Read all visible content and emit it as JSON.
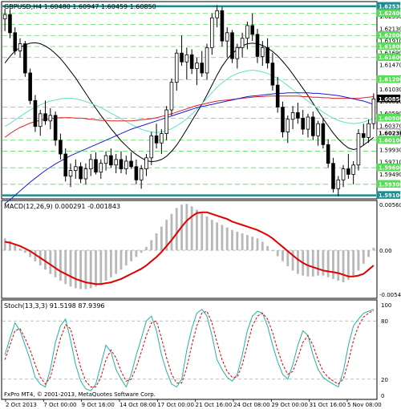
{
  "chart_data": {
    "type": "candlestick",
    "symbol_header": "GBPUSD,H4  1.60480 1.60947 1.60459 1.60850",
    "price_axis": {
      "labels": [
        "1.62350",
        "1.62130",
        "1.61910",
        "1.61690",
        "1.61470",
        "1.61250",
        "1.61030",
        "1.60810",
        "1.60590",
        "1.60370",
        "1.60150",
        "1.59930",
        "1.59710",
        "1.59490"
      ],
      "range": [
        1.5905,
        1.626
      ]
    },
    "horizontal_levels": {
      "heavy": [
        1.6253,
        1.591
      ],
      "dashed": [
        1.624,
        1.622,
        1.62,
        1.618,
        1.616,
        1.612,
        1.607,
        1.605,
        1.601,
        1.599,
        1.596,
        1.593
      ],
      "labels": [
        {
          "value": "1.62530",
          "level": 1.6253,
          "color": "#1e8c8c"
        },
        {
          "value": "1.62400",
          "level": 1.624,
          "color": "#55dd55"
        },
        {
          "value": "1.62000",
          "level": 1.62,
          "color": "#55dd55"
        },
        {
          "value": "1.61800",
          "level": 1.618,
          "color": "#55dd55"
        },
        {
          "value": "1.61600",
          "level": 1.616,
          "color": "#55dd55"
        },
        {
          "value": "1.61200",
          "level": 1.612,
          "color": "#55dd55"
        },
        {
          "value": "1.60850",
          "level": 1.6085,
          "color": "#000000"
        },
        {
          "value": "1.60500",
          "level": 1.605,
          "color": "#55dd55"
        },
        {
          "value": "1.60230",
          "level": 1.6023,
          "color": "#ffffff"
        },
        {
          "value": "1.60100",
          "level": 1.601,
          "color": "#55dd55"
        },
        {
          "value": "1.59600",
          "level": 1.596,
          "color": "#55dd55"
        },
        {
          "value": "1.59300",
          "level": 1.593,
          "color": "#55dd55"
        },
        {
          "value": "1.59100",
          "level": 1.591,
          "color": "#1e8c8c"
        }
      ]
    },
    "candles": [
      [
        1.623,
        1.6248,
        1.6208,
        1.6238
      ],
      [
        1.6238,
        1.6248,
        1.6195,
        1.6205
      ],
      [
        1.6205,
        1.6215,
        1.6165,
        1.6172
      ],
      [
        1.6172,
        1.6195,
        1.616,
        1.6185
      ],
      [
        1.6185,
        1.619,
        1.6125,
        1.6132
      ],
      [
        1.6132,
        1.614,
        1.6075,
        1.6082
      ],
      [
        1.6082,
        1.6092,
        1.6025,
        1.6035
      ],
      [
        1.6035,
        1.6065,
        1.6018,
        1.6058
      ],
      [
        1.6058,
        1.6082,
        1.6038,
        1.6045
      ],
      [
        1.6045,
        1.6068,
        1.603,
        1.6055
      ],
      [
        1.6055,
        1.6062,
        1.6,
        1.601
      ],
      [
        1.601,
        1.6022,
        1.5975,
        1.5985
      ],
      [
        1.5985,
        1.5995,
        1.5935,
        1.5945
      ],
      [
        1.5945,
        1.5968,
        1.5925,
        1.5955
      ],
      [
        1.5955,
        1.5975,
        1.594,
        1.5962
      ],
      [
        1.5962,
        1.597,
        1.5932,
        1.594
      ],
      [
        1.594,
        1.5968,
        1.593,
        1.5958
      ],
      [
        1.5958,
        1.5985,
        1.5945,
        1.5975
      ],
      [
        1.5975,
        1.5988,
        1.5948,
        1.5952
      ],
      [
        1.5952,
        1.5975,
        1.594,
        1.5968
      ],
      [
        1.5968,
        1.599,
        1.5955,
        1.5982
      ],
      [
        1.5982,
        1.5995,
        1.596,
        1.5965
      ],
      [
        1.5965,
        1.5985,
        1.595,
        1.5975
      ],
      [
        1.5975,
        1.599,
        1.595,
        1.5958
      ],
      [
        1.5958,
        1.5982,
        1.5948,
        1.5972
      ],
      [
        1.5972,
        1.5988,
        1.5958,
        1.5962
      ],
      [
        1.5962,
        1.5975,
        1.593,
        1.5938
      ],
      [
        1.5938,
        1.5965,
        1.5922,
        1.5958
      ],
      [
        1.5958,
        1.5985,
        1.5945,
        1.5978
      ],
      [
        1.5978,
        1.6025,
        1.5965,
        1.6018
      ],
      [
        1.6018,
        1.604,
        1.5995,
        1.6005
      ],
      [
        1.6005,
        1.603,
        1.5985,
        1.6022
      ],
      [
        1.6022,
        1.6072,
        1.601,
        1.6065
      ],
      [
        1.6065,
        1.6122,
        1.6055,
        1.6115
      ],
      [
        1.6115,
        1.6175,
        1.61,
        1.6168
      ],
      [
        1.6168,
        1.62,
        1.6145,
        1.6152
      ],
      [
        1.6152,
        1.6178,
        1.612,
        1.6165
      ],
      [
        1.6165,
        1.6175,
        1.613,
        1.614
      ],
      [
        1.614,
        1.616,
        1.611,
        1.615
      ],
      [
        1.615,
        1.6172,
        1.6125,
        1.6132
      ],
      [
        1.6132,
        1.6185,
        1.612,
        1.6178
      ],
      [
        1.6178,
        1.624,
        1.6165,
        1.6232
      ],
      [
        1.6232,
        1.6255,
        1.6215,
        1.6245
      ],
      [
        1.6245,
        1.6252,
        1.618,
        1.619
      ],
      [
        1.619,
        1.6215,
        1.616,
        1.6205
      ],
      [
        1.6205,
        1.621,
        1.615,
        1.6158
      ],
      [
        1.6158,
        1.6185,
        1.614,
        1.6178
      ],
      [
        1.6178,
        1.6205,
        1.616,
        1.6195
      ],
      [
        1.6195,
        1.6225,
        1.6175,
        1.6218
      ],
      [
        1.6218,
        1.624,
        1.619,
        1.6202
      ],
      [
        1.6202,
        1.6212,
        1.615,
        1.6162
      ],
      [
        1.6162,
        1.619,
        1.6145,
        1.6178
      ],
      [
        1.6178,
        1.6195,
        1.614,
        1.615
      ],
      [
        1.615,
        1.6168,
        1.61,
        1.611
      ],
      [
        1.611,
        1.6125,
        1.606,
        1.607
      ],
      [
        1.607,
        1.608,
        1.6015,
        1.6025
      ],
      [
        1.6025,
        1.6055,
        1.6005,
        1.6048
      ],
      [
        1.6048,
        1.6072,
        1.603,
        1.606
      ],
      [
        1.606,
        1.6078,
        1.604,
        1.605
      ],
      [
        1.605,
        1.6065,
        1.602,
        1.603
      ],
      [
        1.603,
        1.6058,
        1.6015,
        1.6052
      ],
      [
        1.6052,
        1.6062,
        1.601,
        1.6018
      ],
      [
        1.6018,
        1.6045,
        1.6,
        1.604
      ],
      [
        1.604,
        1.605,
        1.5995,
        1.6002
      ],
      [
        1.6002,
        1.6012,
        1.596,
        1.5968
      ],
      [
        1.5968,
        1.5978,
        1.5915,
        1.5922
      ],
      [
        1.5922,
        1.5945,
        1.5908,
        1.5938
      ],
      [
        1.5938,
        1.5965,
        1.5925,
        1.5958
      ],
      [
        1.5958,
        1.5985,
        1.594,
        1.5948
      ],
      [
        1.5948,
        1.5972,
        1.593,
        1.5965
      ],
      [
        1.5965,
        1.603,
        1.5955,
        1.6022
      ],
      [
        1.6022,
        1.604,
        1.6,
        1.6015
      ],
      [
        1.6015,
        1.6048,
        1.6005,
        1.604
      ],
      [
        1.604,
        1.6095,
        1.603,
        1.6085
      ]
    ],
    "moving_averages": [
      {
        "color": "#000000",
        "values": [
          1.615,
          1.6162,
          1.6172,
          1.6178,
          1.6183,
          1.6186,
          1.6187,
          1.6185,
          1.6181,
          1.6175,
          1.6167,
          1.6158,
          1.6147,
          1.6135,
          1.6123,
          1.6109,
          1.6095,
          1.6081,
          1.6068,
          1.6055,
          1.6043,
          1.6031,
          1.602,
          1.6009,
          1.6,
          1.5991,
          1.5984,
          1.5978,
          1.5973,
          1.5971,
          1.5972,
          1.5975,
          1.5981,
          1.599,
          1.6001,
          1.6015,
          1.603,
          1.6045,
          1.606,
          1.6075,
          1.6092,
          1.611,
          1.6128,
          1.6144,
          1.6157,
          1.6167,
          1.6175,
          1.6181,
          1.6185,
          1.6186,
          1.6185,
          1.6182,
          1.6177,
          1.6171,
          1.6163,
          1.6153,
          1.6142,
          1.613,
          1.6117,
          1.6104,
          1.6091,
          1.6077,
          1.6063,
          1.6049,
          1.6036,
          1.6023,
          1.6012,
          1.6003,
          1.5996,
          1.5993,
          1.5995,
          1.6001,
          1.6008,
          1.6015
        ]
      },
      {
        "color": "#5de3c7",
        "values": [
          1.6035,
          1.604,
          1.6047,
          1.6053,
          1.6059,
          1.6065,
          1.607,
          1.6074,
          1.6078,
          1.6081,
          1.6083,
          1.6085,
          1.6086,
          1.6086,
          1.6085,
          1.6083,
          1.608,
          1.6077,
          1.6073,
          1.6069,
          1.6064,
          1.6059,
          1.6054,
          1.6049,
          1.6044,
          1.6039,
          1.6034,
          1.603,
          1.6027,
          1.6025,
          1.6024,
          1.6025,
          1.6027,
          1.6031,
          1.6036,
          1.6042,
          1.6049,
          1.6057,
          1.6066,
          1.6076,
          1.6086,
          1.6096,
          1.6106,
          1.6114,
          1.6121,
          1.6127,
          1.6131,
          1.6134,
          1.6136,
          1.6137,
          1.6136,
          1.6134,
          1.6131,
          1.6127,
          1.6122,
          1.6116,
          1.6109,
          1.6102,
          1.6095,
          1.6088,
          1.6081,
          1.6074,
          1.6067,
          1.6061,
          1.6055,
          1.605,
          1.6046,
          1.6043,
          1.6041,
          1.604,
          1.6041,
          1.6043,
          1.6046,
          1.605
        ]
      },
      {
        "color": "#e02020",
        "values": [
          1.6015,
          1.6022,
          1.6028,
          1.6033,
          1.6037,
          1.6041,
          1.6044,
          1.6046,
          1.6048,
          1.6049,
          1.605,
          1.6051,
          1.6051,
          1.6051,
          1.605,
          1.605,
          1.6049,
          1.6048,
          1.6047,
          1.6046,
          1.6046,
          1.6045,
          1.6045,
          1.6045,
          1.6045,
          1.6045,
          1.6046,
          1.6047,
          1.6048,
          1.6049,
          1.6051,
          1.6053,
          1.6055,
          1.6058,
          1.6061,
          1.6064,
          1.6067,
          1.607,
          1.6073,
          1.6075,
          1.6077,
          1.6079,
          1.6081,
          1.6082,
          1.6083,
          1.6084,
          1.6085,
          1.6086,
          1.6087,
          1.6088,
          1.6089,
          1.6089,
          1.609,
          1.609,
          1.609,
          1.609,
          1.609,
          1.609,
          1.609,
          1.6089,
          1.6089,
          1.6088,
          1.6088,
          1.6087,
          1.6087,
          1.6086,
          1.6086,
          1.6086,
          1.6086,
          1.6086,
          1.6086,
          1.6087,
          1.6088,
          1.6089
        ]
      },
      {
        "color": "#1a1ad6",
        "values": [
          1.5895,
          1.5902,
          1.591,
          1.5918,
          1.5926,
          1.5934,
          1.5941,
          1.5948,
          1.5955,
          1.5961,
          1.5967,
          1.5972,
          1.5977,
          1.5982,
          1.5986,
          1.599,
          1.5994,
          1.5998,
          1.6002,
          1.6006,
          1.601,
          1.6014,
          1.6018,
          1.6022,
          1.6026,
          1.603,
          1.6033,
          1.6036,
          1.6039,
          1.6042,
          1.6045,
          1.6048,
          1.6051,
          1.6054,
          1.6057,
          1.606,
          1.6063,
          1.6066,
          1.6069,
          1.6071,
          1.6073,
          1.6075,
          1.6077,
          1.6079,
          1.6081,
          1.6083,
          1.6085,
          1.6087,
          1.6089,
          1.609,
          1.6091,
          1.6092,
          1.6093,
          1.6094,
          1.6095,
          1.6095,
          1.6096,
          1.6096,
          1.6096,
          1.6096,
          1.6096,
          1.6095,
          1.6095,
          1.6094,
          1.6093,
          1.6092,
          1.6091,
          1.6089,
          1.6087,
          1.6085,
          1.6083,
          1.6081,
          1.6078,
          1.6075
        ]
      }
    ],
    "macd": {
      "header": "MACD(12,26,9) 0.000291 -0.001843",
      "axis_labels": [
        "0.005608",
        "0.00",
        "-0.005432"
      ],
      "range": [
        -0.0056,
        0.0058
      ],
      "histogram": [
        0.0014,
        0.0011,
        0.0006,
        0.0002,
        -0.0003,
        -0.0008,
        -0.0013,
        -0.0018,
        -0.0023,
        -0.0028,
        -0.0032,
        -0.0036,
        -0.004,
        -0.0043,
        -0.0045,
        -0.0046,
        -0.0046,
        -0.0045,
        -0.0043,
        -0.004,
        -0.0036,
        -0.0032,
        -0.0028,
        -0.0023,
        -0.0018,
        -0.0013,
        -0.0008,
        -0.0003,
        0.0004,
        0.0012,
        0.002,
        0.0028,
        0.0036,
        0.0043,
        0.005,
        0.0054,
        0.0055,
        0.0052,
        0.0048,
        0.0044,
        0.004,
        0.0036,
        0.0033,
        0.003,
        0.0027,
        0.0024,
        0.0022,
        0.002,
        0.0018,
        0.0016,
        0.0014,
        0.001,
        0.0005,
        -0.0001,
        -0.0007,
        -0.0013,
        -0.0019,
        -0.0024,
        -0.0028,
        -0.003,
        -0.0031,
        -0.0031,
        -0.003,
        -0.003,
        -0.0032,
        -0.0034,
        -0.0036,
        -0.0038,
        -0.0035,
        -0.003,
        -0.0024,
        -0.0016,
        -0.0008,
        0.0003
      ],
      "signal": [
        0.001,
        0.0009,
        0.0007,
        0.0005,
        0.0002,
        -0.0001,
        -0.0005,
        -0.0009,
        -0.0013,
        -0.0017,
        -0.0021,
        -0.0025,
        -0.0028,
        -0.0031,
        -0.0034,
        -0.0036,
        -0.0038,
        -0.0039,
        -0.004,
        -0.004,
        -0.0039,
        -0.0038,
        -0.0036,
        -0.0034,
        -0.0031,
        -0.0028,
        -0.0025,
        -0.0022,
        -0.0018,
        -0.0013,
        -0.0008,
        -0.0002,
        0.0005,
        0.0012,
        0.002,
        0.0028,
        0.0035,
        0.004,
        0.0044,
        0.0045,
        0.0045,
        0.0043,
        0.0041,
        0.0039,
        0.0037,
        0.0034,
        0.0032,
        0.003,
        0.0028,
        0.0026,
        0.0024,
        0.0021,
        0.0018,
        0.0014,
        0.0009,
        0.0004,
        -0.0001,
        -0.0006,
        -0.0011,
        -0.0015,
        -0.0018,
        -0.002,
        -0.0022,
        -0.0024,
        -0.0025,
        -0.0026,
        -0.0027,
        -0.0029,
        -0.0031,
        -0.0031,
        -0.003,
        -0.0028,
        -0.0023,
        -0.0018
      ]
    },
    "stochastic": {
      "header": "Stoch(13,3,3) 91.5198 87.9396",
      "axis_labels": [
        "100",
        "80",
        "20",
        "0"
      ],
      "range": [
        0,
        100
      ],
      "main": [
        45,
        62,
        78,
        70,
        55,
        40,
        22,
        15,
        12,
        30,
        58,
        75,
        82,
        60,
        35,
        18,
        10,
        8,
        15,
        35,
        55,
        48,
        30,
        20,
        12,
        25,
        45,
        62,
        80,
        85,
        70,
        45,
        28,
        15,
        12,
        20,
        50,
        72,
        88,
        92,
        85,
        65,
        40,
        30,
        22,
        18,
        25,
        45,
        70,
        85,
        90,
        88,
        75,
        55,
        38,
        25,
        20,
        35,
        55,
        70,
        65,
        45,
        30,
        22,
        18,
        15,
        12,
        28,
        55,
        75,
        82,
        88,
        90,
        92
      ],
      "signal": [
        40,
        55,
        70,
        72,
        62,
        50,
        35,
        22,
        15,
        22,
        42,
        62,
        76,
        72,
        52,
        32,
        18,
        12,
        12,
        22,
        40,
        50,
        42,
        28,
        18,
        20,
        32,
        48,
        65,
        78,
        80,
        62,
        42,
        25,
        16,
        16,
        32,
        55,
        75,
        88,
        90,
        78,
        58,
        40,
        28,
        22,
        22,
        35,
        55,
        75,
        85,
        88,
        82,
        68,
        50,
        35,
        25,
        28,
        42,
        58,
        65,
        55,
        40,
        28,
        22,
        18,
        15,
        20,
        38,
        60,
        75,
        84,
        88,
        91
      ]
    },
    "time_labels": [
      "2 Oct 2013",
      "7 Oct 00:00",
      "9 Oct 16:00",
      "14 Oct 08:00",
      "17 Oct 00:00",
      "21 Oct 16:00",
      "24 Oct 08:00",
      "29 Oct 00:00",
      "31 Oct 16:00",
      "5 Nov 08:00"
    ],
    "footer": "FxPro MT4, © 2001-2013, MetaQuotes Software Corp."
  }
}
